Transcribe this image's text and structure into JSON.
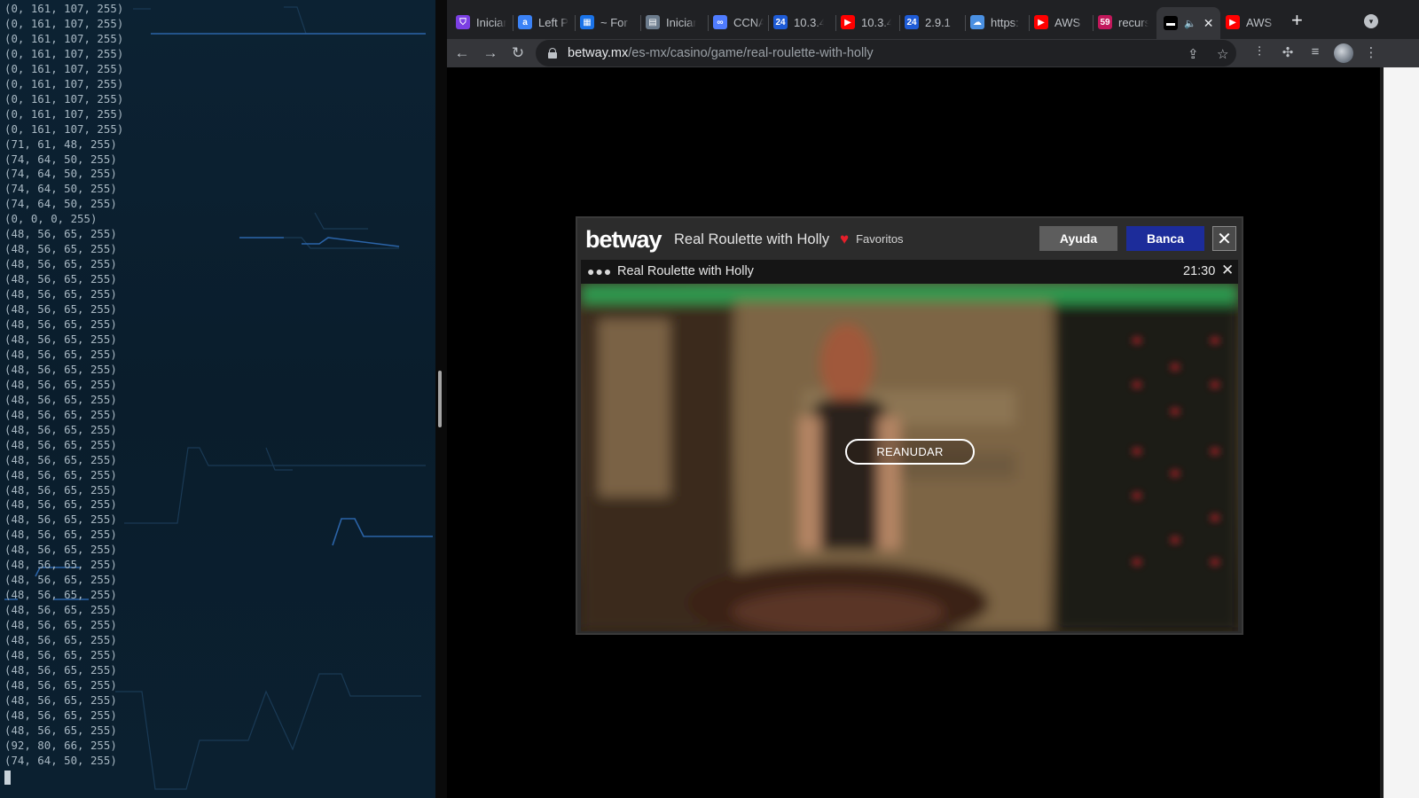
{
  "terminal": {
    "lines": [
      "(0, 161, 107, 255)",
      "(0, 161, 107, 255)",
      "(0, 161, 107, 255)",
      "(0, 161, 107, 255)",
      "(0, 161, 107, 255)",
      "(0, 161, 107, 255)",
      "(0, 161, 107, 255)",
      "(0, 161, 107, 255)",
      "(0, 161, 107, 255)",
      "(71, 61, 48, 255)",
      "(74, 64, 50, 255)",
      "(74, 64, 50, 255)",
      "(74, 64, 50, 255)",
      "(74, 64, 50, 255)",
      "(0, 0, 0, 255)",
      "(48, 56, 65, 255)",
      "(48, 56, 65, 255)",
      "(48, 56, 65, 255)",
      "(48, 56, 65, 255)",
      "(48, 56, 65, 255)",
      "(48, 56, 65, 255)",
      "(48, 56, 65, 255)",
      "(48, 56, 65, 255)",
      "(48, 56, 65, 255)",
      "(48, 56, 65, 255)",
      "(48, 56, 65, 255)",
      "(48, 56, 65, 255)",
      "(48, 56, 65, 255)",
      "(48, 56, 65, 255)",
      "(48, 56, 65, 255)",
      "(48, 56, 65, 255)",
      "(48, 56, 65, 255)",
      "(48, 56, 65, 255)",
      "(48, 56, 65, 255)",
      "(48, 56, 65, 255)",
      "(48, 56, 65, 255)",
      "(48, 56, 65, 255)",
      "(48, 56, 65, 255)",
      "(48, 56, 65, 255)",
      "(48, 56, 65, 255)",
      "(48, 56, 65, 255)",
      "(48, 56, 65, 255)",
      "(48, 56, 65, 255)",
      "(48, 56, 65, 255)",
      "(48, 56, 65, 255)",
      "(48, 56, 65, 255)",
      "(48, 56, 65, 255)",
      "(48, 56, 65, 255)",
      "(48, 56, 65, 255)",
      "(92, 80, 66, 255)",
      "(74, 64, 50, 255)"
    ]
  },
  "browser": {
    "tabs": [
      {
        "title": "Iniciar",
        "icon": "shield-icon",
        "color": "#7b3fe4"
      },
      {
        "title": "Left P",
        "icon": "a-icon",
        "color": "#3b82f6"
      },
      {
        "title": "~ For",
        "icon": "chart-icon",
        "color": "#1a73e8"
      },
      {
        "title": "Iniciar",
        "icon": "cisco-icon",
        "color": "#6b7b8c"
      },
      {
        "title": "CCNA",
        "icon": "link-icon",
        "color": "#4f7cff"
      },
      {
        "title": "10.3.4",
        "icon": "24-icon",
        "color": "#1e5bd6"
      },
      {
        "title": "10.3.4",
        "icon": "youtube-icon",
        "color": "#ff0000"
      },
      {
        "title": "2.9.1",
        "icon": "24-icon",
        "color": "#1e5bd6"
      },
      {
        "title": "https:",
        "icon": "cloud-icon",
        "color": "#4a90e2"
      },
      {
        "title": "AWS",
        "icon": "youtube-icon",
        "color": "#ff0000"
      },
      {
        "title": "recurs",
        "icon": "59-icon",
        "color": "#c2185b"
      },
      {
        "title": "",
        "icon": "betway-icon",
        "color": "#000000",
        "active": true
      },
      {
        "title": "AWS",
        "icon": "youtube-icon",
        "color": "#ff0000"
      }
    ],
    "address": {
      "domain": "betway.mx",
      "path": "/es-mx/casino/game/real-roulette-with-holly"
    }
  },
  "game": {
    "brand": "betway",
    "title": "Real Roulette with Holly",
    "favorites_label": "Favoritos",
    "help_label": "Ayuda",
    "bank_label": "Banca",
    "close_glyph": "✕",
    "frame_title": "Real Roulette with Holly",
    "clock": "21:30",
    "resume_label": "REANUDAR",
    "colors": {
      "bank": "#1c2c9a",
      "heart": "#e51f2a",
      "top_bar": "#23a04a"
    }
  }
}
